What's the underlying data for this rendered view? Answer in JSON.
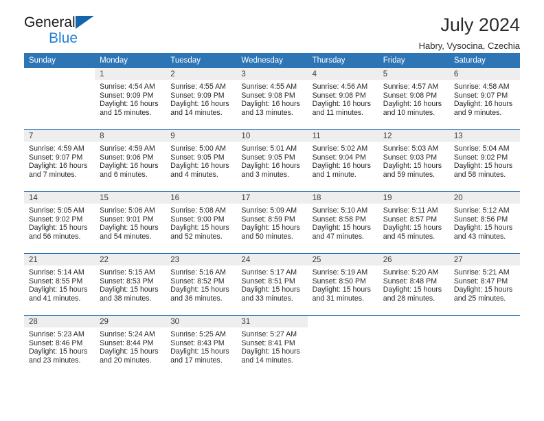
{
  "logo": {
    "word1": "General",
    "word2": "Blue",
    "triangle_color": "#1565ad",
    "word2_color": "#1f7fd4"
  },
  "header": {
    "title": "July 2024",
    "subtitle": "Habry, Vysocina, Czechia"
  },
  "theme": {
    "header_bg": "#2e75b6",
    "daynum_bg": "#eeeeee",
    "rule_color": "#2e75b6"
  },
  "columns": [
    "Sunday",
    "Monday",
    "Tuesday",
    "Wednesday",
    "Thursday",
    "Friday",
    "Saturday"
  ],
  "weeks": [
    [
      {
        "day": "",
        "empty": true,
        "sunrise": "",
        "sunset": "",
        "daylight1": "",
        "daylight2": ""
      },
      {
        "day": "1",
        "sunrise": "Sunrise: 4:54 AM",
        "sunset": "Sunset: 9:09 PM",
        "daylight1": "Daylight: 16 hours",
        "daylight2": "and 15 minutes."
      },
      {
        "day": "2",
        "sunrise": "Sunrise: 4:55 AM",
        "sunset": "Sunset: 9:09 PM",
        "daylight1": "Daylight: 16 hours",
        "daylight2": "and 14 minutes."
      },
      {
        "day": "3",
        "sunrise": "Sunrise: 4:55 AM",
        "sunset": "Sunset: 9:08 PM",
        "daylight1": "Daylight: 16 hours",
        "daylight2": "and 13 minutes."
      },
      {
        "day": "4",
        "sunrise": "Sunrise: 4:56 AM",
        "sunset": "Sunset: 9:08 PM",
        "daylight1": "Daylight: 16 hours",
        "daylight2": "and 11 minutes."
      },
      {
        "day": "5",
        "sunrise": "Sunrise: 4:57 AM",
        "sunset": "Sunset: 9:08 PM",
        "daylight1": "Daylight: 16 hours",
        "daylight2": "and 10 minutes."
      },
      {
        "day": "6",
        "sunrise": "Sunrise: 4:58 AM",
        "sunset": "Sunset: 9:07 PM",
        "daylight1": "Daylight: 16 hours",
        "daylight2": "and 9 minutes."
      }
    ],
    [
      {
        "day": "7",
        "sunrise": "Sunrise: 4:59 AM",
        "sunset": "Sunset: 9:07 PM",
        "daylight1": "Daylight: 16 hours",
        "daylight2": "and 7 minutes."
      },
      {
        "day": "8",
        "sunrise": "Sunrise: 4:59 AM",
        "sunset": "Sunset: 9:06 PM",
        "daylight1": "Daylight: 16 hours",
        "daylight2": "and 6 minutes."
      },
      {
        "day": "9",
        "sunrise": "Sunrise: 5:00 AM",
        "sunset": "Sunset: 9:05 PM",
        "daylight1": "Daylight: 16 hours",
        "daylight2": "and 4 minutes."
      },
      {
        "day": "10",
        "sunrise": "Sunrise: 5:01 AM",
        "sunset": "Sunset: 9:05 PM",
        "daylight1": "Daylight: 16 hours",
        "daylight2": "and 3 minutes."
      },
      {
        "day": "11",
        "sunrise": "Sunrise: 5:02 AM",
        "sunset": "Sunset: 9:04 PM",
        "daylight1": "Daylight: 16 hours",
        "daylight2": "and 1 minute."
      },
      {
        "day": "12",
        "sunrise": "Sunrise: 5:03 AM",
        "sunset": "Sunset: 9:03 PM",
        "daylight1": "Daylight: 15 hours",
        "daylight2": "and 59 minutes."
      },
      {
        "day": "13",
        "sunrise": "Sunrise: 5:04 AM",
        "sunset": "Sunset: 9:02 PM",
        "daylight1": "Daylight: 15 hours",
        "daylight2": "and 58 minutes."
      }
    ],
    [
      {
        "day": "14",
        "sunrise": "Sunrise: 5:05 AM",
        "sunset": "Sunset: 9:02 PM",
        "daylight1": "Daylight: 15 hours",
        "daylight2": "and 56 minutes."
      },
      {
        "day": "15",
        "sunrise": "Sunrise: 5:06 AM",
        "sunset": "Sunset: 9:01 PM",
        "daylight1": "Daylight: 15 hours",
        "daylight2": "and 54 minutes."
      },
      {
        "day": "16",
        "sunrise": "Sunrise: 5:08 AM",
        "sunset": "Sunset: 9:00 PM",
        "daylight1": "Daylight: 15 hours",
        "daylight2": "and 52 minutes."
      },
      {
        "day": "17",
        "sunrise": "Sunrise: 5:09 AM",
        "sunset": "Sunset: 8:59 PM",
        "daylight1": "Daylight: 15 hours",
        "daylight2": "and 50 minutes."
      },
      {
        "day": "18",
        "sunrise": "Sunrise: 5:10 AM",
        "sunset": "Sunset: 8:58 PM",
        "daylight1": "Daylight: 15 hours",
        "daylight2": "and 47 minutes."
      },
      {
        "day": "19",
        "sunrise": "Sunrise: 5:11 AM",
        "sunset": "Sunset: 8:57 PM",
        "daylight1": "Daylight: 15 hours",
        "daylight2": "and 45 minutes."
      },
      {
        "day": "20",
        "sunrise": "Sunrise: 5:12 AM",
        "sunset": "Sunset: 8:56 PM",
        "daylight1": "Daylight: 15 hours",
        "daylight2": "and 43 minutes."
      }
    ],
    [
      {
        "day": "21",
        "sunrise": "Sunrise: 5:14 AM",
        "sunset": "Sunset: 8:55 PM",
        "daylight1": "Daylight: 15 hours",
        "daylight2": "and 41 minutes."
      },
      {
        "day": "22",
        "sunrise": "Sunrise: 5:15 AM",
        "sunset": "Sunset: 8:53 PM",
        "daylight1": "Daylight: 15 hours",
        "daylight2": "and 38 minutes."
      },
      {
        "day": "23",
        "sunrise": "Sunrise: 5:16 AM",
        "sunset": "Sunset: 8:52 PM",
        "daylight1": "Daylight: 15 hours",
        "daylight2": "and 36 minutes."
      },
      {
        "day": "24",
        "sunrise": "Sunrise: 5:17 AM",
        "sunset": "Sunset: 8:51 PM",
        "daylight1": "Daylight: 15 hours",
        "daylight2": "and 33 minutes."
      },
      {
        "day": "25",
        "sunrise": "Sunrise: 5:19 AM",
        "sunset": "Sunset: 8:50 PM",
        "daylight1": "Daylight: 15 hours",
        "daylight2": "and 31 minutes."
      },
      {
        "day": "26",
        "sunrise": "Sunrise: 5:20 AM",
        "sunset": "Sunset: 8:48 PM",
        "daylight1": "Daylight: 15 hours",
        "daylight2": "and 28 minutes."
      },
      {
        "day": "27",
        "sunrise": "Sunrise: 5:21 AM",
        "sunset": "Sunset: 8:47 PM",
        "daylight1": "Daylight: 15 hours",
        "daylight2": "and 25 minutes."
      }
    ],
    [
      {
        "day": "28",
        "sunrise": "Sunrise: 5:23 AM",
        "sunset": "Sunset: 8:46 PM",
        "daylight1": "Daylight: 15 hours",
        "daylight2": "and 23 minutes."
      },
      {
        "day": "29",
        "sunrise": "Sunrise: 5:24 AM",
        "sunset": "Sunset: 8:44 PM",
        "daylight1": "Daylight: 15 hours",
        "daylight2": "and 20 minutes."
      },
      {
        "day": "30",
        "sunrise": "Sunrise: 5:25 AM",
        "sunset": "Sunset: 8:43 PM",
        "daylight1": "Daylight: 15 hours",
        "daylight2": "and 17 minutes."
      },
      {
        "day": "31",
        "sunrise": "Sunrise: 5:27 AM",
        "sunset": "Sunset: 8:41 PM",
        "daylight1": "Daylight: 15 hours",
        "daylight2": "and 14 minutes."
      },
      {
        "day": "",
        "empty": true,
        "sunrise": "",
        "sunset": "",
        "daylight1": "",
        "daylight2": ""
      },
      {
        "day": "",
        "empty": true,
        "sunrise": "",
        "sunset": "",
        "daylight1": "",
        "daylight2": ""
      },
      {
        "day": "",
        "empty": true,
        "sunrise": "",
        "sunset": "",
        "daylight1": "",
        "daylight2": ""
      }
    ]
  ]
}
